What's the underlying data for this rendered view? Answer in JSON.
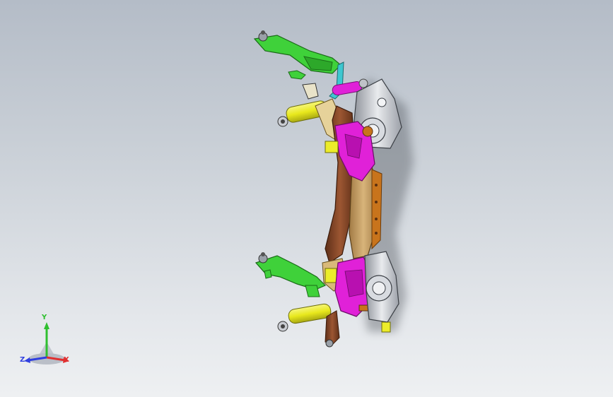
{
  "viewport": {
    "background_top": "#b4bcc7",
    "background_bottom": "#eef0f2"
  },
  "model": {
    "colors": {
      "green": "#3fd13a",
      "magenta": "#e021d8",
      "brown": "#8a4a2a",
      "tan": "#c9a46a",
      "orange": "#c8741c",
      "yellow": "#ecec2a",
      "gray": "#c9ccd2",
      "cyan": "#3ec7d0"
    }
  },
  "triad": {
    "x_label": "X",
    "y_label": "Y",
    "z_label": "Z",
    "x_color": "#e03030",
    "y_color": "#2fbf2f",
    "z_color": "#2f3fe0"
  }
}
